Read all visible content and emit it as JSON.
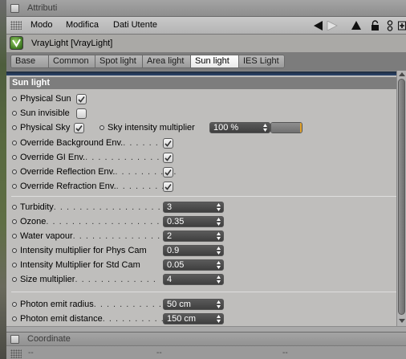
{
  "window": {
    "title": "Attributi"
  },
  "menu": {
    "items": [
      "Modo",
      "Modifica",
      "Dati Utente"
    ]
  },
  "toolbar_icons": [
    "back-arrow-icon",
    "forward-arrow-icon",
    "up-arrow-icon",
    "lock-icon",
    "link-icon",
    "add-icon"
  ],
  "object": {
    "name": "VrayLight [VrayLight]",
    "icon": "vray-logo-icon"
  },
  "tabs": {
    "items": [
      {
        "label": "Base",
        "active": false
      },
      {
        "label": "Common",
        "active": false
      },
      {
        "label": "Spot light",
        "active": false
      },
      {
        "label": "Area light",
        "active": false
      },
      {
        "label": "Sun light",
        "active": true
      },
      {
        "label": "IES Light",
        "active": false
      }
    ]
  },
  "panel": {
    "section_title": "Sun light",
    "physical_sun": {
      "label": "Physical Sun",
      "checked": true
    },
    "sun_invisible": {
      "label": "Sun invisible",
      "checked": false
    },
    "physical_sky": {
      "label": "Physical Sky",
      "checked": true
    },
    "sky_intensity": {
      "label": "Sky intensity multiplier",
      "value": "100 %",
      "slider_fraction": 1.0
    },
    "overrides": [
      {
        "label": "Override Background Env.",
        "leader": ". . . . . . . .",
        "checked": true
      },
      {
        "label": "Override GI Env.",
        "leader": ". . . . . . . . . . . . . .",
        "checked": true
      },
      {
        "label": "Override Reflection Env.",
        "leader": ". . . . . . . . . .",
        "checked": true
      },
      {
        "label": "Override Refraction Env.",
        "leader": ". . . . . . . . .",
        "checked": true
      }
    ],
    "params": [
      {
        "label": "Turbidity",
        "leader": ". . . . . . . . . . . . . . . . .",
        "value": "3"
      },
      {
        "label": "Ozone",
        "leader": ". . . . . . . . . . . . . . . . . . . .",
        "value": "0.35"
      },
      {
        "label": "Water vapour",
        "leader": ". . . . . . . . . . . . . .",
        "value": "2"
      },
      {
        "label": "Intensity multiplier for Phys Cam",
        "leader": "",
        "value": "0.9"
      },
      {
        "label": "Intensity Multiplier for Std Cam",
        "leader": "",
        "value": "0.05"
      },
      {
        "label": "Size multiplier",
        "leader": ". . . . . . . . . . . . .",
        "value": "4"
      }
    ],
    "photon": [
      {
        "label": "Photon emit radius",
        "leader": ". . . . . . . . . . . . .",
        "value": "50 cm"
      },
      {
        "label": "Photon emit distance",
        "leader": ". . . . . . . . . . .",
        "value": "150 cm"
      }
    ]
  },
  "coordinate": {
    "title": "Coordinate",
    "placeholders": [
      "--",
      "--",
      "--"
    ]
  },
  "colors": {
    "panel_bg": "#bfbebc",
    "field_bg": "#4a4a4a",
    "accent_knob": "#e0a028",
    "section_header": "#7d7d7d"
  }
}
